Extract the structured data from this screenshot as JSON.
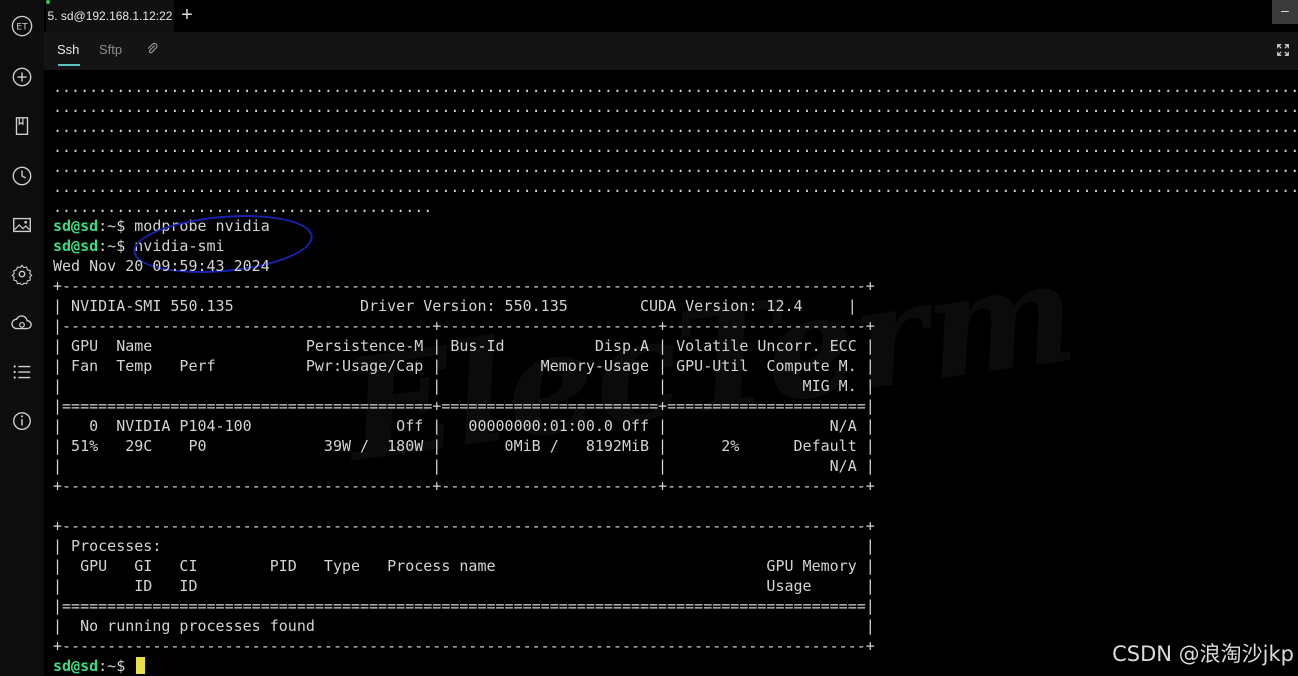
{
  "tabs": {
    "active_label": "5. sd@192.168.1.12:22",
    "new_tab_glyph": "+"
  },
  "window": {
    "minimize_glyph": "–"
  },
  "subtabs": {
    "ssh": "Ssh",
    "sftp": "Sftp"
  },
  "sidebar": {
    "icons": [
      "et-logo-icon",
      "add-icon",
      "bookmark-icon",
      "history-icon",
      "image-icon",
      "settings-icon",
      "cloud-sync-icon",
      "list-icon",
      "info-icon"
    ],
    "logo_text": "ET"
  },
  "terminal": {
    "dots_full": "..............................................................................................................................................",
    "dots_last": "..........................................",
    "prompt_user": "sd@sd",
    "prompt_path": ":~$ ",
    "cmd1": "modprobe nvidia",
    "cmd2": "nvidia-smi",
    "date": "Wed Nov 20 09:59:43 2024",
    "border": "+-----------------------------------------------------------------------------------------+",
    "smi_header": "| NVIDIA-SMI 550.135              Driver Version: 550.135        CUDA Version: 12.4     |",
    "sep1": "|-----------------------------------------+------------------------+----------------------+",
    "col_h1": "| GPU  Name                 Persistence-M | Bus-Id          Disp.A | Volatile Uncorr. ECC |",
    "col_h2": "| Fan  Temp   Perf          Pwr:Usage/Cap |           Memory-Usage | GPU-Util  Compute M. |",
    "col_h3": "|                                         |                        |               MIG M. |",
    "sep_double": "|=========================================+========================+======================|",
    "gpu_r1": "|   0  NVIDIA P104-100                Off |   00000000:01:00.0 Off |                  N/A |",
    "gpu_r2": "| 51%   29C    P0             39W /  180W |       0MiB /   8192MiB |      2%      Default |",
    "gpu_r3": "|                                         |                        |                  N/A |",
    "border_split": "+-----------------------------------------+------------------------+----------------------+",
    "proc_title": "| Processes:                                                                              |",
    "proc_h1": "|  GPU   GI   CI        PID   Type   Process name                              GPU Memory |",
    "proc_h2": "|        ID   ID                                                               Usage      |",
    "proc_sep": "|=========================================================================================|",
    "proc_none": "|  No running processes found                                                             |"
  },
  "colors": {
    "prompt": "#3ddc84",
    "cursor": "#e8e04a",
    "annotation": "#1a22b0"
  },
  "watermark_text": "CSDN @浪淘沙jkp"
}
